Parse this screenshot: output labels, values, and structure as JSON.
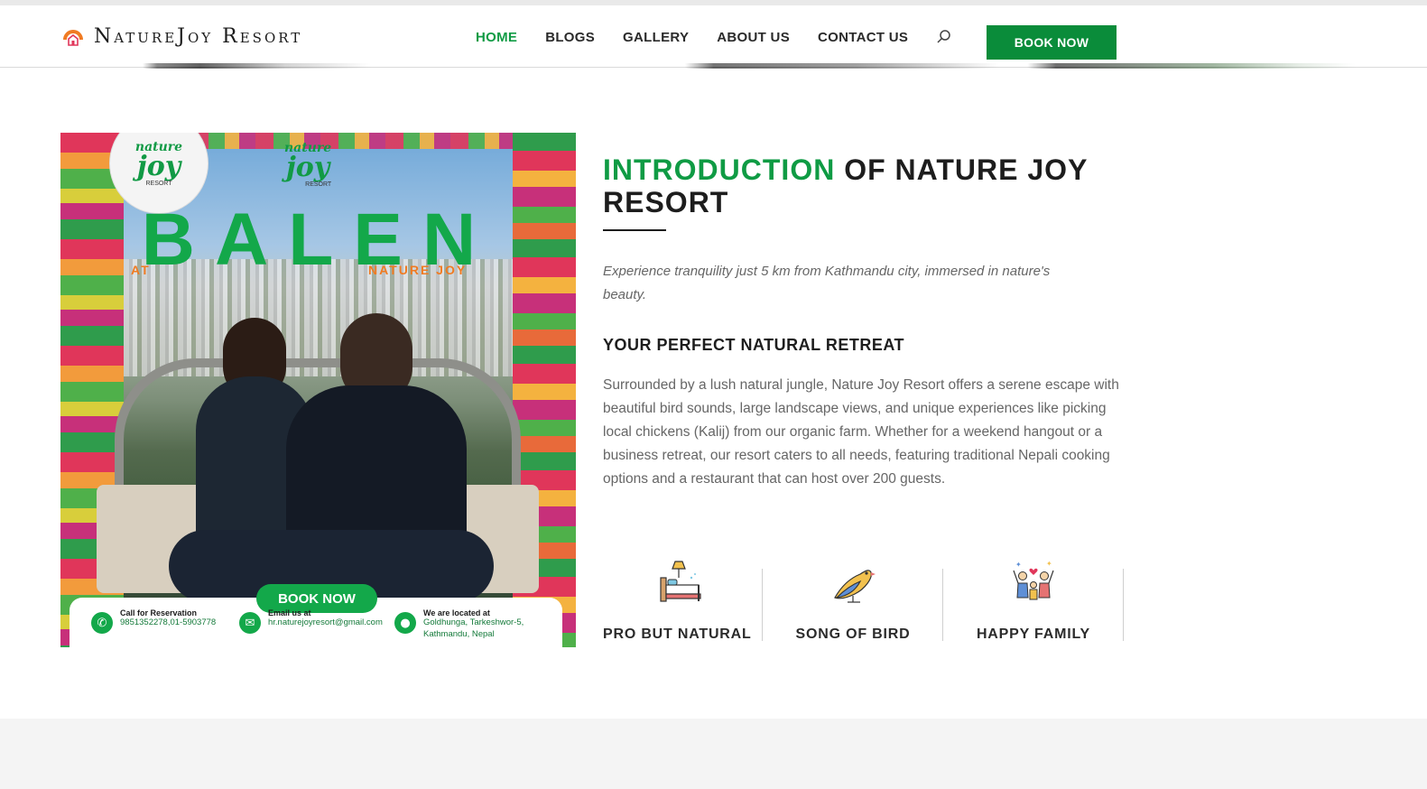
{
  "header": {
    "logo_text": "NatureJoy Resort",
    "nav": [
      {
        "label": "HOME",
        "active": true
      },
      {
        "label": "BLOGS",
        "active": false
      },
      {
        "label": "GALLERY",
        "active": false
      },
      {
        "label": "ABOUT US",
        "active": false
      },
      {
        "label": "CONTACT US",
        "active": false
      }
    ],
    "search_icon": "search-icon",
    "book_button": "BOOK NOW"
  },
  "poster": {
    "brand_top": "nature",
    "brand_main": "joy",
    "brand_sub": "RESORT",
    "title": "BALEN",
    "at_left": "AT",
    "at_right": "NATURE JOY",
    "book_pill": "BOOK NOW",
    "call_label": "Call for Reservation",
    "call_value": "9851352278,01-5903778",
    "email_label": "Email us at",
    "email_value": "hr.naturejoyresort@gmail.com",
    "location_label": "We are located at",
    "location_value_1": "Goldhunga, Tarkeshwor-5,",
    "location_value_2": "Kathmandu, Nepal"
  },
  "intro": {
    "heading_green": "INTRODUCTION",
    "heading_rest": " OF NATURE JOY RESORT",
    "lead": "Experience tranquility just 5 km from Kathmandu city, immersed in nature's beauty.",
    "subhead": "YOUR PERFECT NATURAL RETREAT",
    "body": "Surrounded by a lush natural jungle, Nature Joy Resort offers a serene escape with beautiful bird sounds, large landscape views, and unique experiences like picking local chickens (Kalij) from our organic farm. Whether for a weekend hangout or a business retreat, our resort caters to all needs, featuring traditional Nepali cooking options and a restaurant that can host over 200 guests."
  },
  "features": [
    {
      "label": "PRO BUT NATURAL",
      "icon": "bed-lamp-icon"
    },
    {
      "label": "SONG OF BIRD",
      "icon": "bird-icon"
    },
    {
      "label": "HAPPY FAMILY",
      "icon": "family-icon"
    }
  ],
  "colors": {
    "accent": "#0f9b44",
    "button": "#0a8c3a",
    "logo_orange": "#f07b22"
  }
}
